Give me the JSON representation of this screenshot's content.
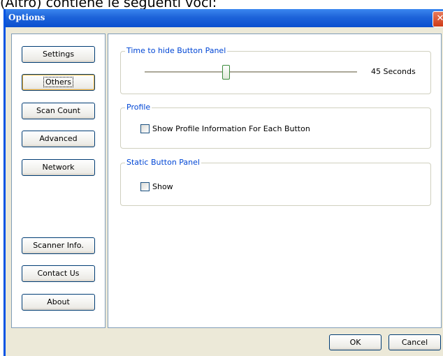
{
  "caption": "(Altro) contiene le seguenti voci:",
  "window": {
    "title": "Options",
    "close_glyph": "✕",
    "close_icon": "close-icon"
  },
  "nav": {
    "items": [
      {
        "label": "Settings",
        "selected": false
      },
      {
        "label": "Others",
        "selected": true
      },
      {
        "label": "Scan Count",
        "selected": false
      },
      {
        "label": "Advanced",
        "selected": false
      },
      {
        "label": "Network",
        "selected": false
      }
    ],
    "bottom_items": [
      {
        "label": "Scanner Info."
      },
      {
        "label": "Contact Us"
      },
      {
        "label": "About"
      }
    ]
  },
  "panel": {
    "hide_panel": {
      "title": "Time to hide Button Panel",
      "slider_fraction": 0.38,
      "value_text": "45 Seconds"
    },
    "profile": {
      "title": "Profile",
      "checkbox_label": "Show Profile Information For Each Button",
      "checked": false
    },
    "static_panel": {
      "title": "Static Button Panel",
      "checkbox_label": "Show",
      "checked": false
    }
  },
  "footer": {
    "ok_label": "OK",
    "cancel_label": "Cancel"
  }
}
